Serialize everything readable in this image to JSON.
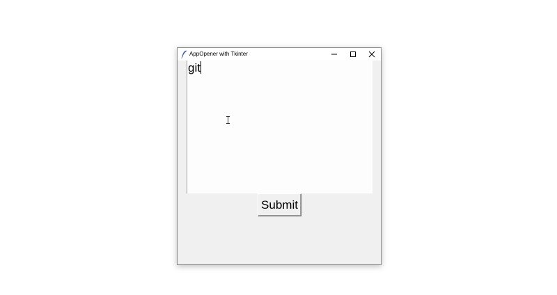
{
  "window": {
    "title": "AppOpener with Tkinter",
    "icon": "feather-icon",
    "controls": {
      "minimize_icon": "minimize-icon",
      "maximize_icon": "maximize-icon",
      "close_icon": "close-icon"
    }
  },
  "text_area": {
    "value": "git",
    "cursor_icon": "ibeam-cursor-icon"
  },
  "submit": {
    "label": "Submit"
  }
}
